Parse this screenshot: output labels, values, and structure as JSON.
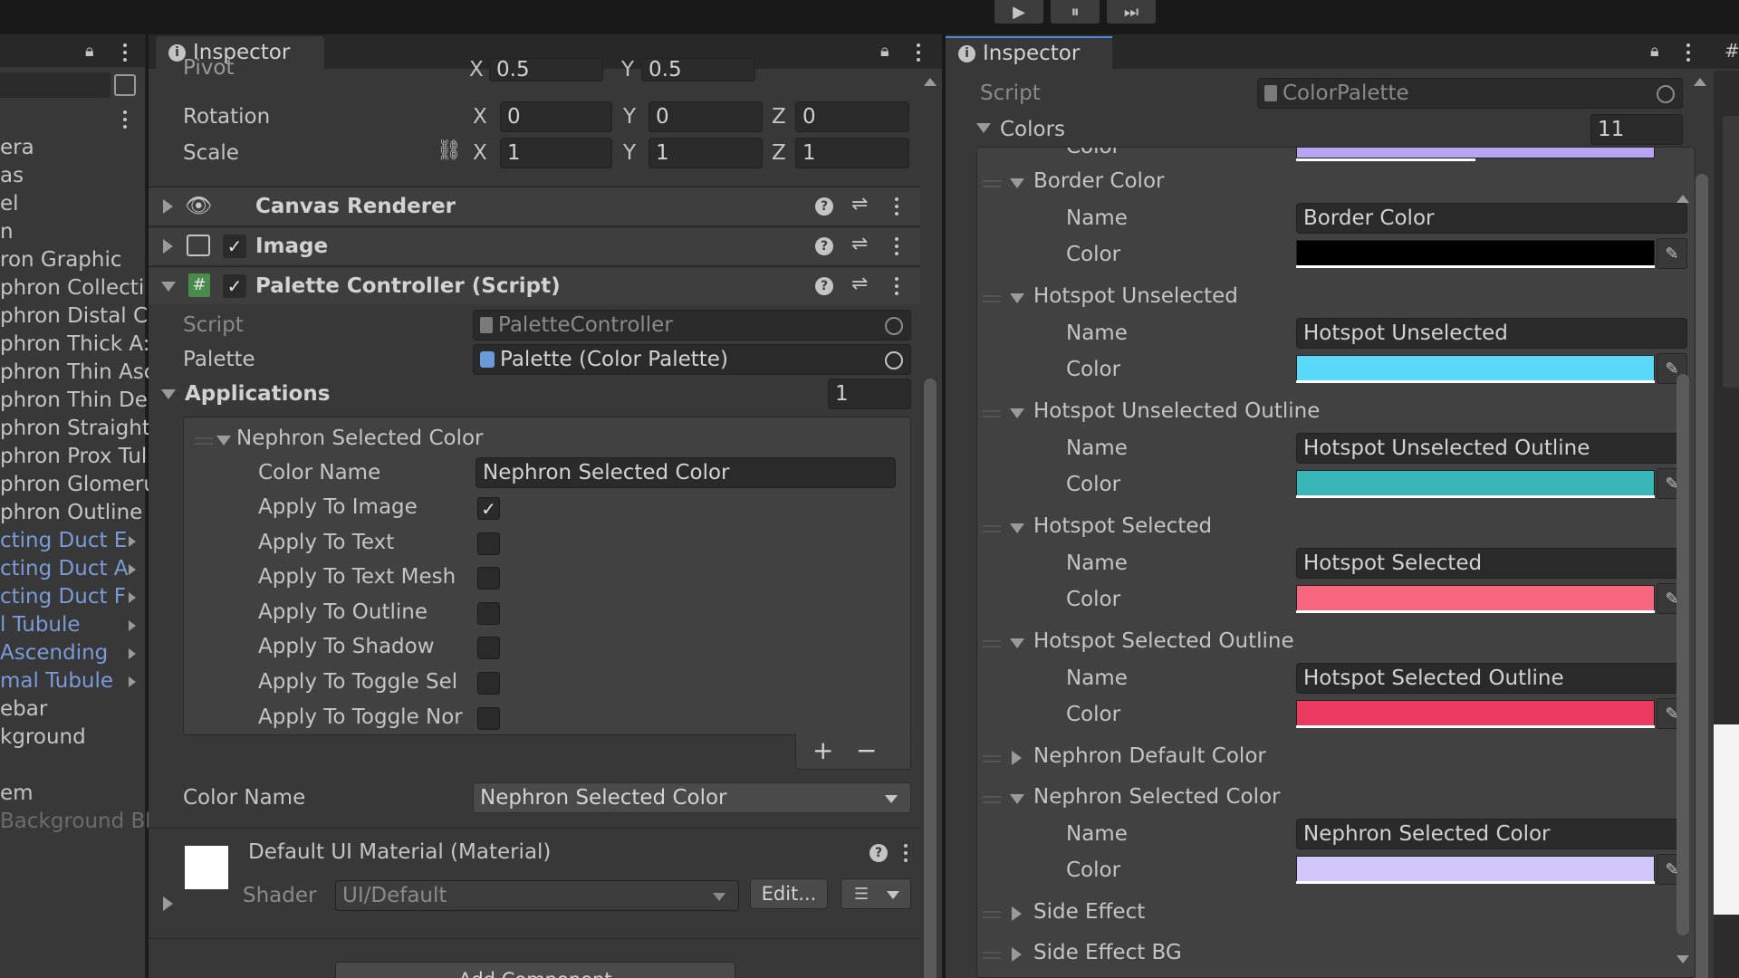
{
  "toolbar": {
    "play_label": "▶",
    "pause_label": "⏸",
    "step_label": "⏭"
  },
  "hierarchy": {
    "items": [
      {
        "label": "era",
        "link": false
      },
      {
        "label": "as",
        "link": false
      },
      {
        "label": "el",
        "link": false
      },
      {
        "label": "n",
        "link": false
      },
      {
        "label": "ron Graphic",
        "link": false
      },
      {
        "label": "phron Collecti",
        "link": false
      },
      {
        "label": "phron Distal C",
        "link": false
      },
      {
        "label": "phron Thick A:",
        "link": false
      },
      {
        "label": "phron Thin Asc",
        "link": false
      },
      {
        "label": "phron Thin De",
        "link": false
      },
      {
        "label": "phron Straight",
        "link": false
      },
      {
        "label": "phron Prox Tul",
        "link": false
      },
      {
        "label": "phron Glomeru",
        "link": false
      },
      {
        "label": "phron Outline",
        "link": false
      },
      {
        "label": "cting Duct E",
        "link": true
      },
      {
        "label": "cting Duct A",
        "link": true
      },
      {
        "label": "cting Duct F",
        "link": true
      },
      {
        "label": "l Tubule",
        "link": true
      },
      {
        "label": "Ascending",
        "link": true
      },
      {
        "label": "mal Tubule",
        "link": true
      },
      {
        "label": "ebar",
        "link": false
      },
      {
        "label": "kground",
        "link": false
      },
      {
        "label": "",
        "link": false
      },
      {
        "label": "em",
        "link": false
      },
      {
        "label": "Background Bl",
        "link": false
      }
    ]
  },
  "left_inspector": {
    "tab_label": "Inspector",
    "pivot_label": "Pivot",
    "pivot_x": "0.5",
    "pivot_y": "0.5",
    "rotation_label": "Rotation",
    "rotation": {
      "x": "0",
      "y": "0",
      "z": "0"
    },
    "scale_label": "Scale",
    "scale": {
      "x": "1",
      "y": "1",
      "z": "1"
    },
    "axis": {
      "x": "X",
      "y": "Y",
      "z": "Z"
    },
    "components": [
      {
        "label": "Canvas Renderer"
      },
      {
        "label": "Image"
      },
      {
        "label": "Palette Controller (Script)"
      }
    ],
    "script_label": "Script",
    "script_value": "PaletteController",
    "palette_label": "Palette",
    "palette_value": "Palette (Color Palette)",
    "applications_label": "Applications",
    "applications_count": "1",
    "element_label": "Nephron Selected Color",
    "color_name_label": "Color Name",
    "color_name_value": "Nephron Selected Color",
    "toggles": [
      {
        "label": "Apply To Image",
        "checked": true
      },
      {
        "label": "Apply To Text",
        "checked": false
      },
      {
        "label": "Apply To Text Mesh",
        "checked": false
      },
      {
        "label": "Apply To Outline",
        "checked": false
      },
      {
        "label": "Apply To Shadow",
        "checked": false
      },
      {
        "label": "Apply To Toggle Sel",
        "checked": false
      },
      {
        "label": "Apply To Toggle Nor",
        "checked": false
      }
    ],
    "add_label": "+",
    "remove_label": "−",
    "color_name2_label": "Color Name",
    "color_name2_value": "Nephron Selected Color",
    "material_label": "Default UI Material (Material)",
    "shader_label": "Shader",
    "shader_value": "UI/Default",
    "edit_label": "Edit...",
    "add_component_label": "Add Component"
  },
  "right_inspector": {
    "tab_label": "Inspector",
    "script_label": "Script",
    "script_value": "ColorPalette",
    "colors_label": "Colors",
    "colors_count": "11",
    "top_partial_label": "Color",
    "entries": [
      {
        "title": "Border Color",
        "expanded": true,
        "name_label": "Name",
        "name": "Border Color",
        "color_label": "Color",
        "color": "#000000"
      },
      {
        "title": "Hotspot Unselected",
        "expanded": true,
        "name_label": "Name",
        "name": "Hotspot Unselected",
        "color_label": "Color",
        "color": "#5ad8f7"
      },
      {
        "title": "Hotspot Unselected Outline",
        "expanded": true,
        "name_label": "Name",
        "name": "Hotspot Unselected Outline",
        "color_label": "Color",
        "color": "#38b6b8"
      },
      {
        "title": "Hotspot Selected",
        "expanded": true,
        "name_label": "Name",
        "name": "Hotspot Selected",
        "color_label": "Color",
        "color": "#f6667f"
      },
      {
        "title": "Hotspot Selected Outline",
        "expanded": true,
        "name_label": "Name",
        "name": "Hotspot Selected Outline",
        "color_label": "Color",
        "color": "#ea3a60"
      },
      {
        "title": "Nephron Default Color",
        "expanded": false
      },
      {
        "title": "Nephron Selected Color",
        "expanded": true,
        "name_label": "Name",
        "name": "Nephron Selected Color",
        "color_label": "Color",
        "color": "#d1c7fb"
      },
      {
        "title": "Side Effect",
        "expanded": false
      },
      {
        "title": "Side Effect BG",
        "expanded": false
      }
    ]
  },
  "colors": {
    "bg": "#191919",
    "panel": "#383838",
    "field": "#2a2a2a",
    "link": "#7a9ad8",
    "accent": "#4c8ad6"
  }
}
